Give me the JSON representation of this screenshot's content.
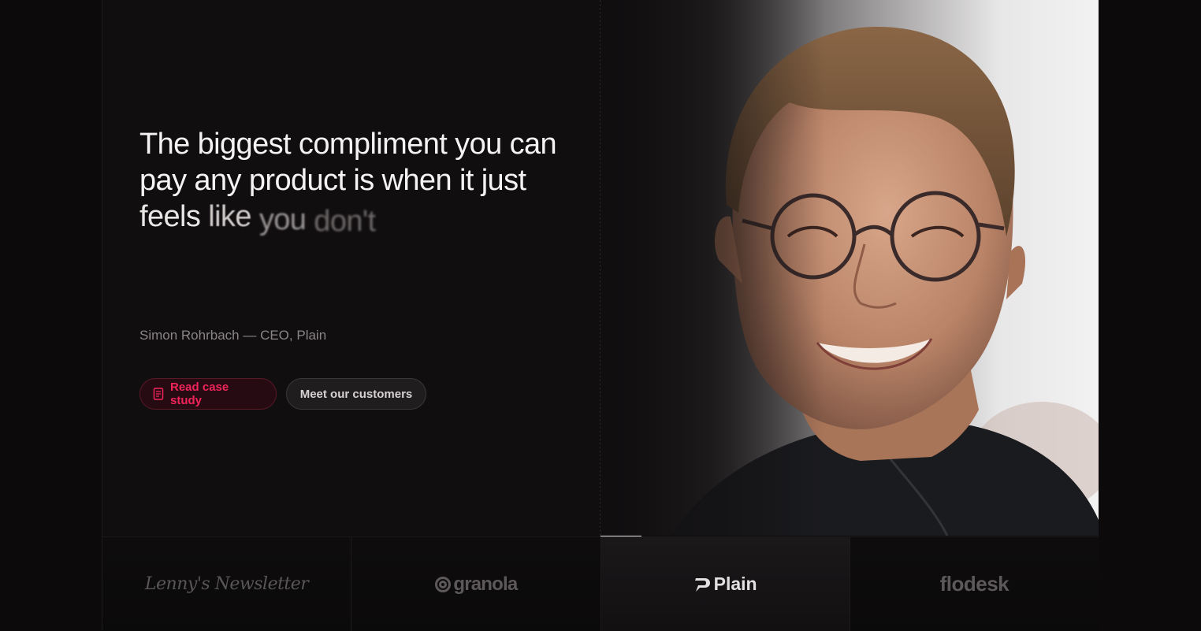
{
  "testimonial": {
    "quote_main": "The biggest compliment you can pay any product is when it just ",
    "quote_fade": [
      "feels",
      "like",
      "you",
      "don't"
    ],
    "author": "Simon Rohrbach — CEO, Plain"
  },
  "actions": {
    "case_study_label": "Read case study",
    "customers_label": "Meet our customers"
  },
  "carousel": {
    "progress": 0.16,
    "active_index": 2
  },
  "logos": [
    {
      "name": "Lenny's Newsletter"
    },
    {
      "name": "granola"
    },
    {
      "name": "Plain"
    },
    {
      "name": "flodesk"
    }
  ],
  "colors": {
    "accent": "#f0245a",
    "background": "#0c0a0b",
    "panel": "#100e0f"
  },
  "icons": {
    "case_study": "document-icon",
    "granola": "granola-logo-icon",
    "plain": "plain-logo-icon"
  }
}
